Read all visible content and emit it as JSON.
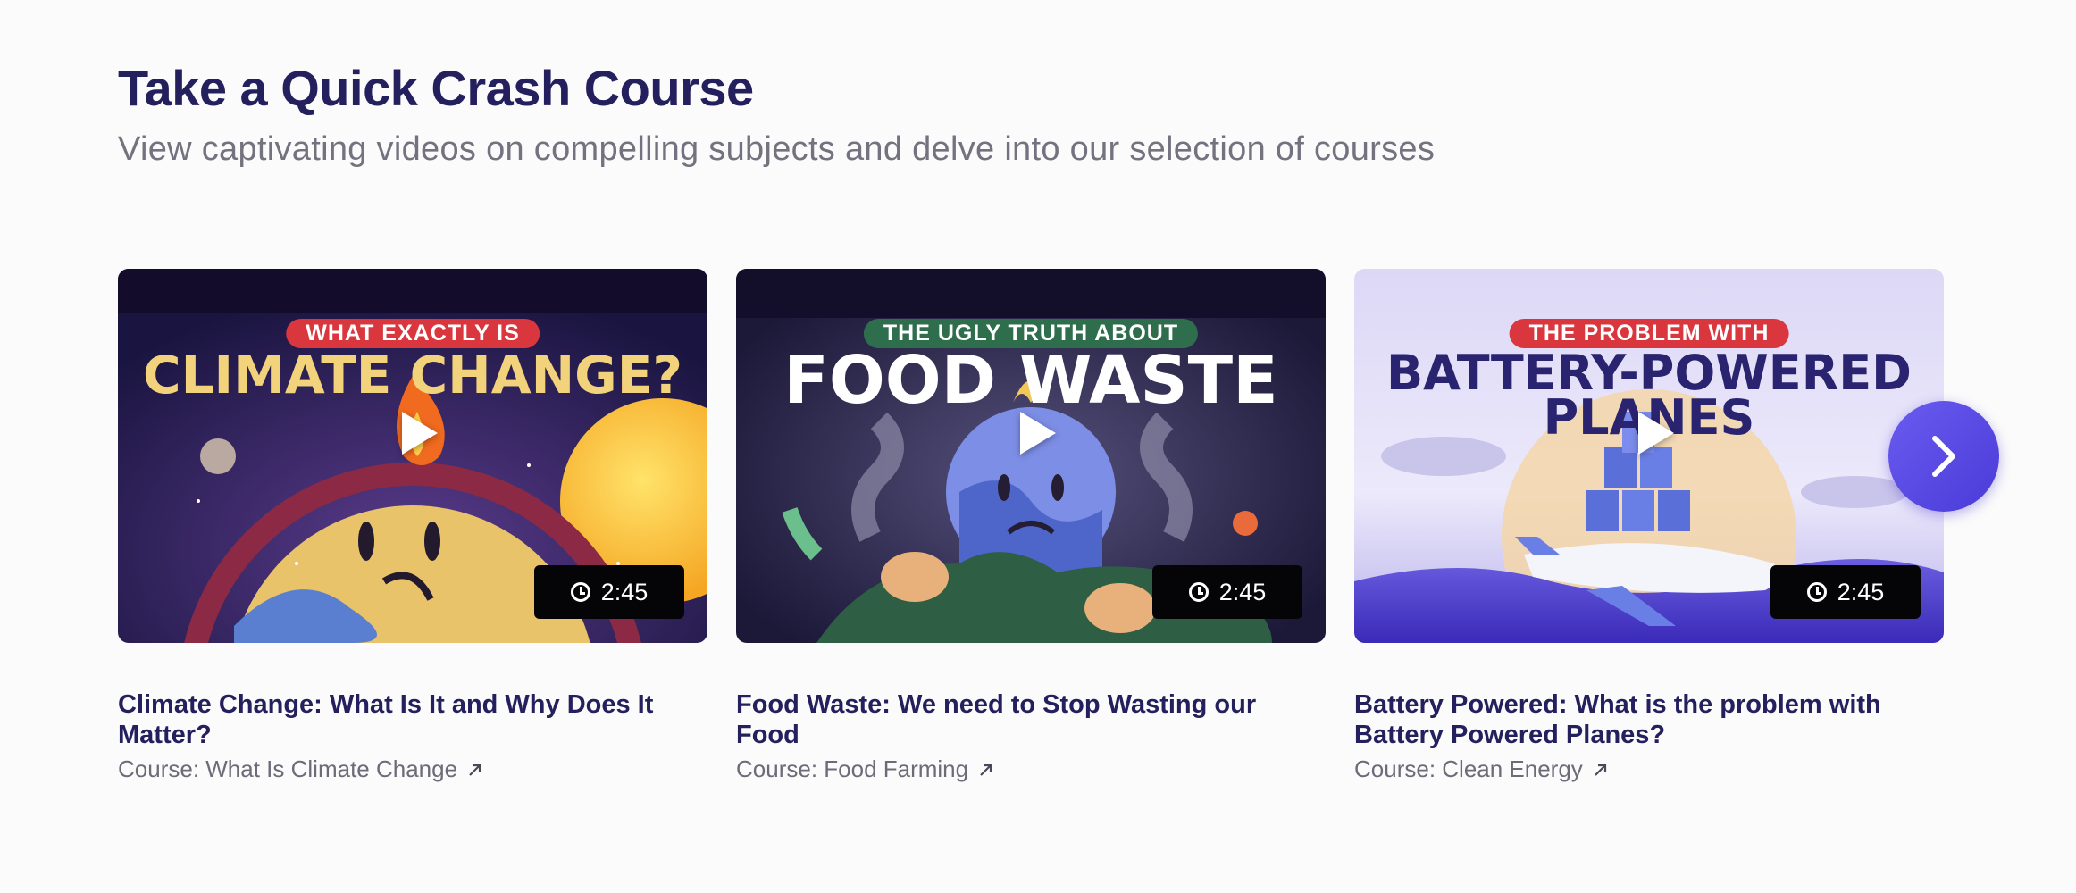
{
  "section": {
    "title": "Take a Quick Crash Course",
    "subtitle": "View captivating videos on compelling subjects and delve into our selection of courses"
  },
  "cards": [
    {
      "kicker": "WHAT EXACTLY IS",
      "big_title": "CLIMATE CHANGE?",
      "duration": "2:45",
      "title": "Climate Change: What Is It and Why Does It Matter?",
      "course": "Course: What Is Climate Change",
      "kicker_color": "#d9363e"
    },
    {
      "kicker": "THE UGLY TRUTH ABOUT",
      "big_title": "FOOD WASTE",
      "duration": "2:45",
      "title": "Food Waste: We need to Stop Wasting our Food",
      "course": "Course: Food Farming",
      "kicker_color": "#2f6e4d"
    },
    {
      "kicker": "THE PROBLEM WITH",
      "big_title_line1": "BATTERY-POWERED",
      "big_title_line2": "PLANES",
      "duration": "2:45",
      "title": "Battery Powered: What is the problem with Battery Powered Planes?",
      "course": "Course: Clean Energy",
      "kicker_color": "#d9363e"
    }
  ],
  "icons": {
    "play": "play-icon",
    "clock": "clock-icon",
    "external": "arrow-up-right-icon",
    "next": "chevron-right-icon"
  },
  "colors": {
    "heading": "#24205e",
    "accent": "#5b4be6"
  }
}
